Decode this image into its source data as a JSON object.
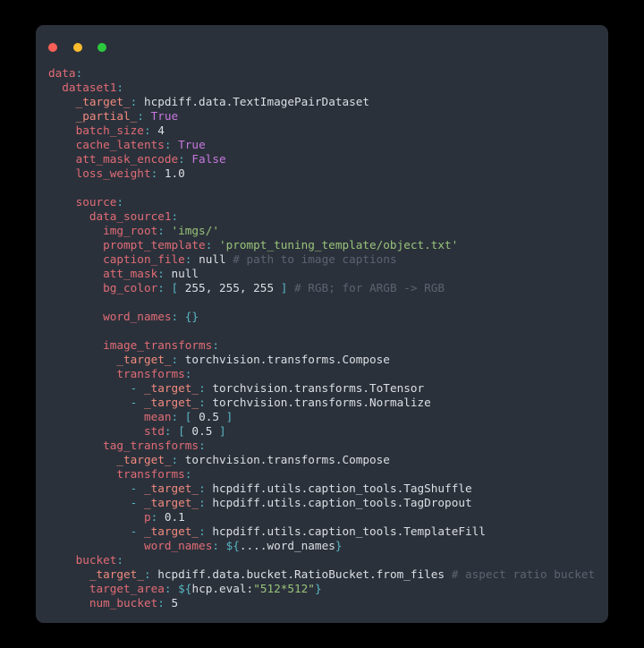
{
  "window": {
    "title": "",
    "traffic_lights": [
      {
        "name": "close-button",
        "color": "#fa5f57"
      },
      {
        "name": "minimize-button",
        "color": "#fcbc2d"
      },
      {
        "name": "maximize-button",
        "color": "#2cc93f"
      }
    ],
    "background": "#2b313b",
    "page_background": "#000000"
  },
  "theme": {
    "key": "#e06c75",
    "target_key": "#ef8a7d",
    "punctuation": "#56b6c2",
    "string": "#98c379",
    "boolean": "#c678dd",
    "plain": "#dcdfe4",
    "comment": "#5c6370"
  },
  "code": {
    "language": "yaml",
    "lines": [
      "data:",
      "  dataset1:",
      "    _target_: hcpdiff.data.TextImagePairDataset",
      "    _partial_: True",
      "    batch_size: 4",
      "    cache_latents: True",
      "    att_mask_encode: False",
      "    loss_weight: 1.0",
      "",
      "    source:",
      "      data_source1:",
      "        img_root: 'imgs/'",
      "        prompt_template: 'prompt_tuning_template/object.txt'",
      "        caption_file: null # path to image captions",
      "        att_mask: null",
      "        bg_color: [ 255, 255, 255 ] # RGB; for ARGB -> RGB",
      "",
      "        word_names: {}",
      "",
      "        image_transforms:",
      "          _target_: torchvision.transforms.Compose",
      "          transforms:",
      "            - _target_: torchvision.transforms.ToTensor",
      "            - _target_: torchvision.transforms.Normalize",
      "              mean: [ 0.5 ]",
      "              std: [ 0.5 ]",
      "        tag_transforms:",
      "          _target_: torchvision.transforms.Compose",
      "          transforms:",
      "            - _target_: hcpdiff.utils.caption_tools.TagShuffle",
      "            - _target_: hcpdiff.utils.caption_tools.TagDropout",
      "              p: 0.1",
      "            - _target_: hcpdiff.utils.caption_tools.TemplateFill",
      "              word_names: ${....word_names}",
      "    bucket:",
      "      _target_: hcpdiff.data.bucket.RatioBucket.from_files # aspect ratio bucket",
      "      target_area: ${hcp.eval:\"512*512\"}",
      "      num_bucket: 5"
    ],
    "tokens": [
      [
        {
          "t": "data",
          "c": "k"
        },
        {
          "t": ":",
          "c": "c"
        }
      ],
      [
        {
          "t": "  ",
          "c": "p"
        },
        {
          "t": "dataset1",
          "c": "k"
        },
        {
          "t": ":",
          "c": "c"
        }
      ],
      [
        {
          "t": "    ",
          "c": "p"
        },
        {
          "t": "_target_",
          "c": "tg"
        },
        {
          "t": ":",
          "c": "c"
        },
        {
          "t": " hcpdiff.data.TextImagePairDataset",
          "c": "p"
        }
      ],
      [
        {
          "t": "    ",
          "c": "p"
        },
        {
          "t": "_partial_",
          "c": "tg"
        },
        {
          "t": ":",
          "c": "c"
        },
        {
          "t": " ",
          "c": "p"
        },
        {
          "t": "True",
          "c": "b"
        }
      ],
      [
        {
          "t": "    ",
          "c": "p"
        },
        {
          "t": "batch_size",
          "c": "k"
        },
        {
          "t": ":",
          "c": "c"
        },
        {
          "t": " ",
          "c": "p"
        },
        {
          "t": "4",
          "c": "n"
        }
      ],
      [
        {
          "t": "    ",
          "c": "p"
        },
        {
          "t": "cache_latents",
          "c": "k"
        },
        {
          "t": ":",
          "c": "c"
        },
        {
          "t": " ",
          "c": "p"
        },
        {
          "t": "True",
          "c": "b"
        }
      ],
      [
        {
          "t": "    ",
          "c": "p"
        },
        {
          "t": "att_mask_encode",
          "c": "k"
        },
        {
          "t": ":",
          "c": "c"
        },
        {
          "t": " ",
          "c": "p"
        },
        {
          "t": "False",
          "c": "b"
        }
      ],
      [
        {
          "t": "    ",
          "c": "p"
        },
        {
          "t": "loss_weight",
          "c": "k"
        },
        {
          "t": ":",
          "c": "c"
        },
        {
          "t": " ",
          "c": "p"
        },
        {
          "t": "1.0",
          "c": "n"
        }
      ],
      [],
      [
        {
          "t": "    ",
          "c": "p"
        },
        {
          "t": "source",
          "c": "k"
        },
        {
          "t": ":",
          "c": "c"
        }
      ],
      [
        {
          "t": "      ",
          "c": "p"
        },
        {
          "t": "data_source1",
          "c": "k"
        },
        {
          "t": ":",
          "c": "c"
        }
      ],
      [
        {
          "t": "        ",
          "c": "p"
        },
        {
          "t": "img_root",
          "c": "k"
        },
        {
          "t": ":",
          "c": "c"
        },
        {
          "t": " ",
          "c": "p"
        },
        {
          "t": "'imgs/'",
          "c": "s"
        }
      ],
      [
        {
          "t": "        ",
          "c": "p"
        },
        {
          "t": "prompt_template",
          "c": "k"
        },
        {
          "t": ":",
          "c": "c"
        },
        {
          "t": " ",
          "c": "p"
        },
        {
          "t": "'prompt_tuning_template/object.txt'",
          "c": "s"
        }
      ],
      [
        {
          "t": "        ",
          "c": "p"
        },
        {
          "t": "caption_file",
          "c": "k"
        },
        {
          "t": ":",
          "c": "c"
        },
        {
          "t": " ",
          "c": "p"
        },
        {
          "t": "null",
          "c": "n"
        },
        {
          "t": " ",
          "c": "p"
        },
        {
          "t": "# path to image captions",
          "c": "cm"
        }
      ],
      [
        {
          "t": "        ",
          "c": "p"
        },
        {
          "t": "att_mask",
          "c": "k"
        },
        {
          "t": ":",
          "c": "c"
        },
        {
          "t": " ",
          "c": "p"
        },
        {
          "t": "null",
          "c": "n"
        }
      ],
      [
        {
          "t": "        ",
          "c": "p"
        },
        {
          "t": "bg_color",
          "c": "k"
        },
        {
          "t": ":",
          "c": "c"
        },
        {
          "t": " ",
          "c": "p"
        },
        {
          "t": "[",
          "c": "c"
        },
        {
          "t": " 255, 255, 255 ",
          "c": "n"
        },
        {
          "t": "]",
          "c": "c"
        },
        {
          "t": " ",
          "c": "p"
        },
        {
          "t": "# RGB; for ARGB -> RGB",
          "c": "cm"
        }
      ],
      [],
      [
        {
          "t": "        ",
          "c": "p"
        },
        {
          "t": "word_names",
          "c": "k"
        },
        {
          "t": ":",
          "c": "c"
        },
        {
          "t": " ",
          "c": "p"
        },
        {
          "t": "{}",
          "c": "c"
        }
      ],
      [],
      [
        {
          "t": "        ",
          "c": "p"
        },
        {
          "t": "image_transforms",
          "c": "k"
        },
        {
          "t": ":",
          "c": "c"
        }
      ],
      [
        {
          "t": "          ",
          "c": "p"
        },
        {
          "t": "_target_",
          "c": "tg"
        },
        {
          "t": ":",
          "c": "c"
        },
        {
          "t": " torchvision.transforms.Compose",
          "c": "p"
        }
      ],
      [
        {
          "t": "          ",
          "c": "p"
        },
        {
          "t": "transforms",
          "c": "k"
        },
        {
          "t": ":",
          "c": "c"
        }
      ],
      [
        {
          "t": "            ",
          "c": "p"
        },
        {
          "t": "-",
          "c": "d"
        },
        {
          "t": " ",
          "c": "p"
        },
        {
          "t": "_target_",
          "c": "tg"
        },
        {
          "t": ":",
          "c": "c"
        },
        {
          "t": " torchvision.transforms.ToTensor",
          "c": "p"
        }
      ],
      [
        {
          "t": "            ",
          "c": "p"
        },
        {
          "t": "-",
          "c": "d"
        },
        {
          "t": " ",
          "c": "p"
        },
        {
          "t": "_target_",
          "c": "tg"
        },
        {
          "t": ":",
          "c": "c"
        },
        {
          "t": " torchvision.transforms.Normalize",
          "c": "p"
        }
      ],
      [
        {
          "t": "              ",
          "c": "p"
        },
        {
          "t": "mean",
          "c": "k"
        },
        {
          "t": ":",
          "c": "c"
        },
        {
          "t": " ",
          "c": "p"
        },
        {
          "t": "[",
          "c": "c"
        },
        {
          "t": " 0.5 ",
          "c": "n"
        },
        {
          "t": "]",
          "c": "c"
        }
      ],
      [
        {
          "t": "              ",
          "c": "p"
        },
        {
          "t": "std",
          "c": "k"
        },
        {
          "t": ":",
          "c": "c"
        },
        {
          "t": " ",
          "c": "p"
        },
        {
          "t": "[",
          "c": "c"
        },
        {
          "t": " 0.5 ",
          "c": "n"
        },
        {
          "t": "]",
          "c": "c"
        }
      ],
      [
        {
          "t": "        ",
          "c": "p"
        },
        {
          "t": "tag_transforms",
          "c": "k"
        },
        {
          "t": ":",
          "c": "c"
        }
      ],
      [
        {
          "t": "          ",
          "c": "p"
        },
        {
          "t": "_target_",
          "c": "tg"
        },
        {
          "t": ":",
          "c": "c"
        },
        {
          "t": " torchvision.transforms.Compose",
          "c": "p"
        }
      ],
      [
        {
          "t": "          ",
          "c": "p"
        },
        {
          "t": "transforms",
          "c": "k"
        },
        {
          "t": ":",
          "c": "c"
        }
      ],
      [
        {
          "t": "            ",
          "c": "p"
        },
        {
          "t": "-",
          "c": "d"
        },
        {
          "t": " ",
          "c": "p"
        },
        {
          "t": "_target_",
          "c": "tg"
        },
        {
          "t": ":",
          "c": "c"
        },
        {
          "t": " hcpdiff.utils.caption_tools.TagShuffle",
          "c": "p"
        }
      ],
      [
        {
          "t": "            ",
          "c": "p"
        },
        {
          "t": "-",
          "c": "d"
        },
        {
          "t": " ",
          "c": "p"
        },
        {
          "t": "_target_",
          "c": "tg"
        },
        {
          "t": ":",
          "c": "c"
        },
        {
          "t": " hcpdiff.utils.caption_tools.TagDropout",
          "c": "p"
        }
      ],
      [
        {
          "t": "              ",
          "c": "p"
        },
        {
          "t": "p",
          "c": "k"
        },
        {
          "t": ":",
          "c": "c"
        },
        {
          "t": " ",
          "c": "p"
        },
        {
          "t": "0.1",
          "c": "n"
        }
      ],
      [
        {
          "t": "            ",
          "c": "p"
        },
        {
          "t": "-",
          "c": "d"
        },
        {
          "t": " ",
          "c": "p"
        },
        {
          "t": "_target_",
          "c": "tg"
        },
        {
          "t": ":",
          "c": "c"
        },
        {
          "t": " hcpdiff.utils.caption_tools.TemplateFill",
          "c": "p"
        }
      ],
      [
        {
          "t": "              ",
          "c": "p"
        },
        {
          "t": "word_names",
          "c": "k"
        },
        {
          "t": ":",
          "c": "c"
        },
        {
          "t": " ",
          "c": "p"
        },
        {
          "t": "${",
          "c": "c"
        },
        {
          "t": "....word_names",
          "c": "p"
        },
        {
          "t": "}",
          "c": "c"
        }
      ],
      [
        {
          "t": "    ",
          "c": "p"
        },
        {
          "t": "bucket",
          "c": "k"
        },
        {
          "t": ":",
          "c": "c"
        }
      ],
      [
        {
          "t": "      ",
          "c": "p"
        },
        {
          "t": "_target_",
          "c": "tg"
        },
        {
          "t": ":",
          "c": "c"
        },
        {
          "t": " hcpdiff.data.bucket.RatioBucket.from_files",
          "c": "p"
        },
        {
          "t": " ",
          "c": "p"
        },
        {
          "t": "# aspect ratio bucket",
          "c": "cm"
        }
      ],
      [
        {
          "t": "      ",
          "c": "p"
        },
        {
          "t": "target_area",
          "c": "k"
        },
        {
          "t": ":",
          "c": "c"
        },
        {
          "t": " ",
          "c": "p"
        },
        {
          "t": "${",
          "c": "c"
        },
        {
          "t": "hcp.eval:",
          "c": "p"
        },
        {
          "t": "\"512*512\"",
          "c": "s"
        },
        {
          "t": "}",
          "c": "c"
        }
      ],
      [
        {
          "t": "      ",
          "c": "p"
        },
        {
          "t": "num_bucket",
          "c": "k"
        },
        {
          "t": ":",
          "c": "c"
        },
        {
          "t": " ",
          "c": "p"
        },
        {
          "t": "5",
          "c": "n"
        }
      ]
    ]
  }
}
